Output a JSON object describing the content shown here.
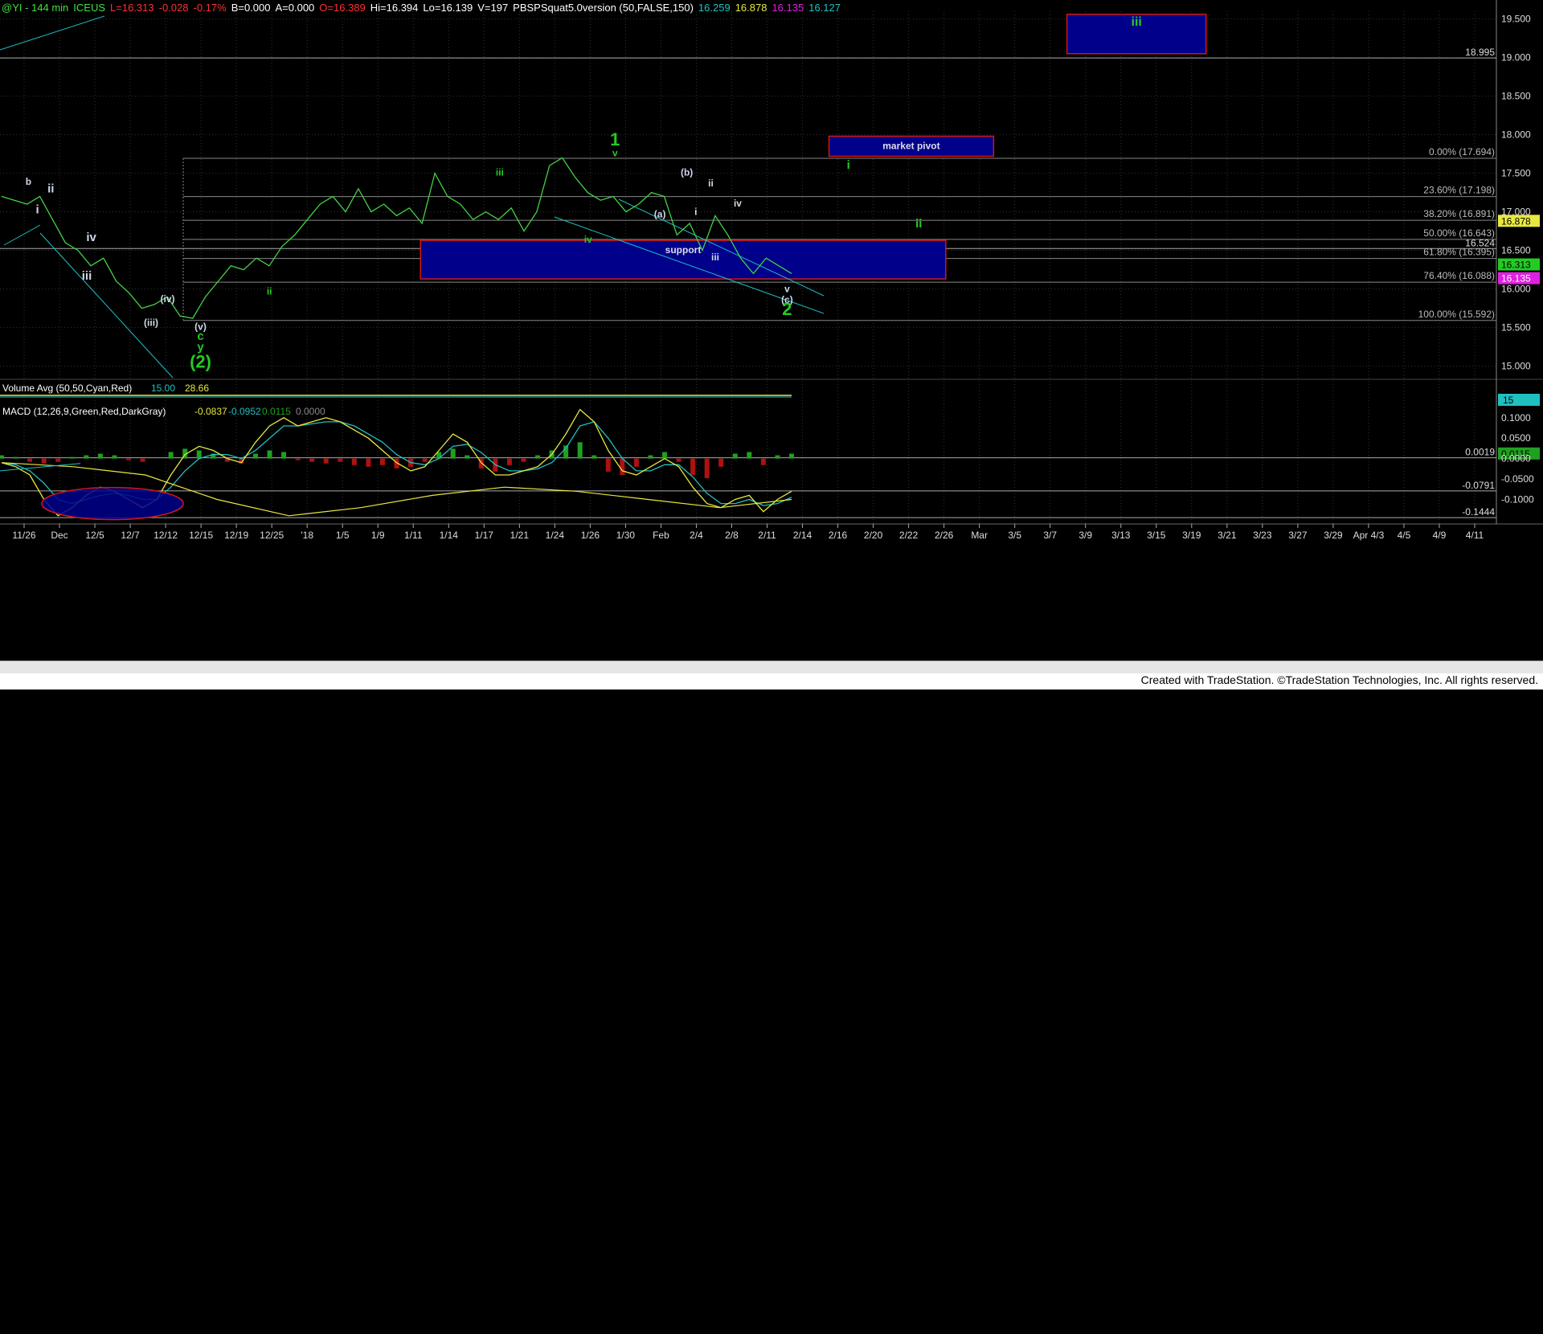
{
  "header": {
    "title": "@YI - 144 min",
    "exchange": "ICEUS",
    "last": "L=16.313",
    "chg": "-0.028",
    "pct": "-0.17%",
    "b": "B=0.000",
    "a": "A=0.000",
    "open": "O=16.389",
    "hi": "Hi=16.394",
    "lo": "Lo=16.139",
    "vol": "V=197",
    "indicator": "PBSPSquat5.0version (50,FALSE,150)",
    "v1": "16.259",
    "v2": "16.878",
    "v3": "16.135",
    "v4": "16.127"
  },
  "colors": {
    "background": "#000000",
    "price": "#44d244",
    "wave_green": "#22cc22",
    "wave_white": "#cfd8e8",
    "box_fill": "#00008b",
    "box_border": "#d01818",
    "fib_text": "#bbbbbb",
    "cyan": "#20c0c0",
    "yellow": "#e8e840",
    "red_hist": "#b01010",
    "green_hist": "#20a020"
  },
  "chart_data": [
    {
      "type": "line",
      "title": "@YI - 144 min",
      "x_ticks": [
        "11/26",
        "Dec",
        "12/5",
        "12/7",
        "12/12",
        "12/15",
        "12/19",
        "12/25",
        "'18",
        "1/5",
        "1/9",
        "1/11",
        "1/14",
        "1/17",
        "1/21",
        "1/24",
        "1/26",
        "1/30",
        "Feb",
        "2/4",
        "2/8",
        "2/11",
        "2/14",
        "2/16",
        "2/20",
        "2/22",
        "2/26",
        "Mar",
        "3/5",
        "3/7",
        "3/9",
        "3/13",
        "3/15",
        "3/19",
        "3/21",
        "3/23",
        "3/27",
        "3/29",
        "Apr 4/3",
        "4/5",
        "4/9",
        "4/11"
      ],
      "y_ticks": [
        "19.500",
        "19.000",
        "18.500",
        "18.000",
        "17.500",
        "17.000",
        "16.500",
        "16.000",
        "15.500",
        "15.000"
      ],
      "ylim": [
        14.85,
        19.6
      ],
      "series": [
        {
          "values": [
            17.2,
            17.15,
            17.1,
            17.2,
            16.9,
            16.6,
            16.5,
            16.3,
            16.4,
            16.1,
            15.95,
            15.75,
            15.8,
            15.9,
            15.65,
            15.62,
            15.9,
            16.1,
            16.3,
            16.25,
            16.4,
            16.3,
            16.55,
            16.7,
            16.9,
            17.1,
            17.2,
            17.0,
            17.3,
            17.0,
            17.1,
            16.95,
            17.05,
            16.85,
            17.5,
            17.2,
            17.1,
            16.9,
            17.0,
            16.9,
            17.05,
            16.75,
            17.0,
            17.6,
            17.7,
            17.45,
            17.25,
            17.15,
            17.2,
            17.0,
            17.1,
            17.25,
            17.2,
            16.7,
            16.85,
            16.5,
            16.95,
            16.7,
            16.4,
            16.2,
            16.4,
            16.3,
            16.2
          ]
        }
      ],
      "fib_levels": [
        {
          "label": "0.00% (17.694)",
          "value": 17.694
        },
        {
          "label": "23.60% (17.198)",
          "value": 17.198
        },
        {
          "label": "38.20% (16.891)",
          "value": 16.891
        },
        {
          "label": "50.00% (16.643)",
          "value": 16.643
        },
        {
          "label": "61.80% (16.395)",
          "value": 16.395
        },
        {
          "label": "76.40% (16.088)",
          "value": 16.088
        },
        {
          "label": "100.00% (15.592)",
          "value": 15.592
        }
      ],
      "price_tags": [
        {
          "value": "18.995",
          "y": 18.995
        },
        {
          "value": "16.524",
          "y": 16.524
        }
      ],
      "axis_badges": [
        {
          "text": "16.878",
          "y": 16.878,
          "bg": "#e8e840",
          "fg": "#000"
        },
        {
          "text": "16.313",
          "y": 16.313,
          "bg": "#22cc22",
          "fg": "#000"
        },
        {
          "text": "16.135",
          "y": 16.135,
          "bg": "#e020e0",
          "fg": "#fff"
        }
      ],
      "boxes": [
        {
          "label": "iii",
          "y_top": 19.56,
          "y_bottom": 19.05,
          "x_start": 0.713,
          "x_end": 0.806,
          "label_color": "green"
        },
        {
          "label": "market pivot",
          "y_top": 17.98,
          "y_bottom": 17.72,
          "x_start": 0.554,
          "x_end": 0.664,
          "label_color": "white"
        },
        {
          "label": "support",
          "y_top": 16.63,
          "y_bottom": 16.13,
          "x_start": 0.281,
          "x_end": 0.632,
          "label_color": "white"
        }
      ],
      "wave_labels": [
        {
          "text": "b",
          "x": 0.019,
          "y": 17.35,
          "color": "white",
          "size": "s"
        },
        {
          "text": "ii",
          "x": 0.034,
          "y": 17.25,
          "color": "white",
          "size": "m"
        },
        {
          "text": "i",
          "x": 0.025,
          "y": 16.98,
          "color": "white",
          "size": "m"
        },
        {
          "text": "iv",
          "x": 0.061,
          "y": 16.62,
          "color": "white",
          "size": "m"
        },
        {
          "text": "iii",
          "x": 0.058,
          "y": 16.12,
          "color": "white",
          "size": "m"
        },
        {
          "text": "(iv)",
          "x": 0.112,
          "y": 15.83,
          "color": "white",
          "size": "s"
        },
        {
          "text": "(iii)",
          "x": 0.101,
          "y": 15.52,
          "color": "white",
          "size": "s"
        },
        {
          "text": "(v)",
          "x": 0.134,
          "y": 15.47,
          "color": "white",
          "size": "s"
        },
        {
          "text": "c",
          "x": 0.134,
          "y": 15.34,
          "color": "green",
          "size": "m"
        },
        {
          "text": "y",
          "x": 0.134,
          "y": 15.2,
          "color": "green",
          "size": "m"
        },
        {
          "text": "(2)",
          "x": 0.134,
          "y": 14.98,
          "color": "green",
          "size": "l"
        },
        {
          "text": "ii",
          "x": 0.18,
          "y": 15.93,
          "color": "green",
          "size": "s"
        },
        {
          "text": "iii",
          "x": 0.334,
          "y": 17.47,
          "color": "green",
          "size": "s"
        },
        {
          "text": "iv",
          "x": 0.393,
          "y": 16.6,
          "color": "green",
          "size": "s"
        },
        {
          "text": "1",
          "x": 0.411,
          "y": 17.86,
          "color": "green",
          "size": "l"
        },
        {
          "text": "v",
          "x": 0.411,
          "y": 17.72,
          "color": "green",
          "size": "s"
        },
        {
          "text": "(b)",
          "x": 0.459,
          "y": 17.47,
          "color": "white",
          "size": "s"
        },
        {
          "text": "ii",
          "x": 0.475,
          "y": 17.33,
          "color": "white",
          "size": "s"
        },
        {
          "text": "iv",
          "x": 0.493,
          "y": 17.07,
          "color": "white",
          "size": "s"
        },
        {
          "text": "(a)",
          "x": 0.441,
          "y": 16.93,
          "color": "white",
          "size": "s"
        },
        {
          "text": "i",
          "x": 0.465,
          "y": 16.96,
          "color": "white",
          "size": "s"
        },
        {
          "text": "iii",
          "x": 0.478,
          "y": 16.37,
          "color": "white",
          "size": "s"
        },
        {
          "text": "v",
          "x": 0.526,
          "y": 15.96,
          "color": "white",
          "size": "s"
        },
        {
          "text": "(c)",
          "x": 0.526,
          "y": 15.82,
          "color": "white",
          "size": "s"
        },
        {
          "text": "2",
          "x": 0.526,
          "y": 15.66,
          "color": "green",
          "size": "l"
        },
        {
          "text": "i",
          "x": 0.567,
          "y": 17.56,
          "color": "green",
          "size": "m"
        },
        {
          "text": "ii",
          "x": 0.614,
          "y": 16.8,
          "color": "green",
          "size": "m"
        }
      ]
    },
    {
      "type": "bar",
      "title": "Volume Avg (50,50,Cyan,Red)",
      "labels": [
        "15.00",
        "28.66"
      ],
      "axis_badge": "15"
    },
    {
      "type": "line",
      "title": "MACD (12,26,9,Green,Red,DarkGray)",
      "labels": [
        "-0.0837",
        "-0.0952",
        "0.0115",
        "0.0000"
      ],
      "y_ticks": [
        "0.1000",
        "0.0500",
        "0.0000",
        "-0.0500",
        "-0.1000"
      ],
      "ylim": [
        -0.16,
        0.135
      ],
      "price_tags": [
        {
          "value": "0.0019",
          "y": 0.0019
        },
        {
          "value": "-0.0791",
          "y": -0.0791
        },
        {
          "value": "-0.1444",
          "y": -0.1444
        }
      ],
      "axis_badge": "0.0115",
      "macd": [
        -0.01,
        -0.02,
        -0.04,
        -0.1,
        -0.14,
        -0.12,
        -0.09,
        -0.07,
        -0.08,
        -0.1,
        -0.12,
        -0.1,
        -0.04,
        0.01,
        0.03,
        0.02,
        0.0,
        -0.01,
        0.04,
        0.08,
        0.1,
        0.08,
        0.09,
        0.1,
        0.09,
        0.07,
        0.05,
        0.02,
        -0.01,
        -0.03,
        -0.02,
        0.02,
        0.06,
        0.04,
        -0.01,
        -0.04,
        -0.04,
        -0.03,
        -0.02,
        0.01,
        0.06,
        0.12,
        0.09,
        0.02,
        -0.03,
        -0.04,
        -0.02,
        0.0,
        -0.02,
        -0.07,
        -0.11,
        -0.12,
        -0.1,
        -0.09,
        -0.13,
        -0.1,
        -0.08
      ],
      "signal": [
        -0.01,
        -0.015,
        -0.03,
        -0.06,
        -0.1,
        -0.11,
        -0.1,
        -0.09,
        -0.085,
        -0.09,
        -0.1,
        -0.1,
        -0.07,
        -0.03,
        0.0,
        0.01,
        0.01,
        0.0,
        0.02,
        0.05,
        0.08,
        0.08,
        0.085,
        0.09,
        0.09,
        0.08,
        0.06,
        0.04,
        0.01,
        -0.01,
        -0.015,
        0.0,
        0.03,
        0.035,
        0.015,
        -0.015,
        -0.03,
        -0.03,
        -0.025,
        -0.01,
        0.025,
        0.08,
        0.09,
        0.05,
        0.0,
        -0.03,
        -0.03,
        -0.015,
        -0.015,
        -0.045,
        -0.085,
        -0.11,
        -0.11,
        -0.1,
        -0.115,
        -0.11,
        -0.095
      ],
      "hist": [
        0.004,
        0.002,
        -0.004,
        -0.006,
        -0.004,
        0.002,
        0.004,
        0.006,
        0.004,
        -0.002,
        -0.004,
        0.0,
        0.008,
        0.012,
        0.01,
        0.006,
        -0.004,
        -0.006,
        0.006,
        0.01,
        0.008,
        -0.002,
        -0.004,
        -0.006,
        -0.004,
        -0.008,
        -0.01,
        -0.008,
        -0.012,
        -0.01,
        -0.004,
        0.008,
        0.012,
        0.004,
        -0.012,
        -0.016,
        -0.008,
        -0.004,
        0.004,
        0.01,
        0.016,
        0.02,
        0.004,
        -0.016,
        -0.02,
        -0.01,
        0.004,
        0.008,
        -0.004,
        -0.02,
        -0.024,
        -0.01,
        0.006,
        0.008,
        -0.008,
        0.004,
        0.006
      ]
    }
  ],
  "footer": "Created with TradeStation. ©TradeStation Technologies, Inc. All rights reserved."
}
